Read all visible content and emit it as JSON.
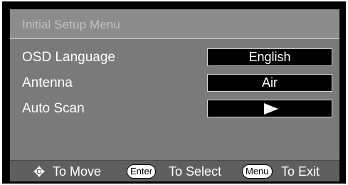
{
  "menu": {
    "title": "Initial Setup Menu",
    "items": [
      {
        "label": "OSD Language",
        "value": "English",
        "value_type": "text"
      },
      {
        "label": "Antenna",
        "value": "Air",
        "value_type": "text"
      },
      {
        "label": "Auto Scan",
        "value": "",
        "value_type": "play-icon"
      }
    ]
  },
  "footer": {
    "move_label": "To Move",
    "enter_key": "Enter",
    "select_label": "To Select",
    "menu_key": "Menu",
    "exit_label": "To Exit",
    "move_icon": "navigation-arrows-icon"
  },
  "colors": {
    "frame": "#000000",
    "panel": "#7a7a7a",
    "title_bar": "#8c8c8c",
    "footer_bar": "#5f5f5f",
    "value_box": "#000000",
    "text": "#ffffff"
  }
}
